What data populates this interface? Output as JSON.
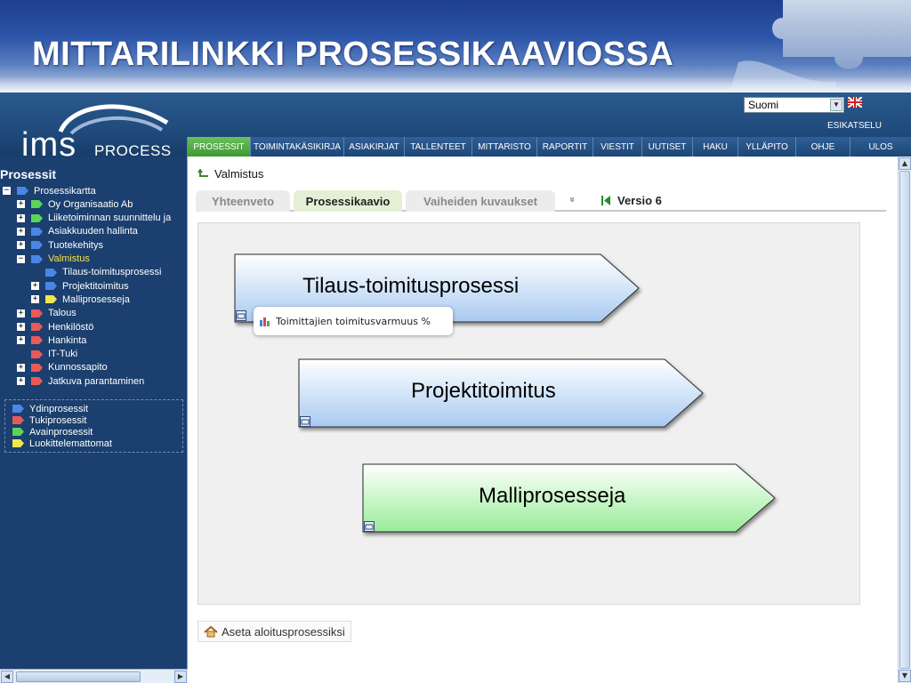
{
  "banner": {
    "title": "MITTARILINKKI PROSESSIKAAVIOSSA"
  },
  "header": {
    "logo_main": "IMS",
    "logo_sub": "PROCESS",
    "language_selected": "Suomi",
    "preview_label": "ESIKATSELU"
  },
  "nav": {
    "items": [
      {
        "label": "PROSESSIT",
        "active": true
      },
      {
        "label": "TOIMINTAKÄSIKIRJA"
      },
      {
        "label": "ASIAKIRJAT"
      },
      {
        "label": "TALLENTEET"
      },
      {
        "label": "MITTARISTO"
      },
      {
        "label": "RAPORTIT"
      },
      {
        "label": "VIESTIT"
      },
      {
        "label": "UUTISET"
      },
      {
        "label": "HAKU"
      },
      {
        "label": "YLLÄPITO"
      },
      {
        "label": "OHJE"
      },
      {
        "label": "ULOS"
      }
    ]
  },
  "sidebar": {
    "title": "Prosessit",
    "tree": [
      {
        "label": "Prosessikartta",
        "expander": "−",
        "color": "#4a86e8"
      },
      {
        "label": "Oy Organisaatio Ab",
        "expander": "+",
        "color": "#5bd45b"
      },
      {
        "label": "Liiketoiminnan suunnittelu ja",
        "expander": "+",
        "color": "#5bd45b"
      },
      {
        "label": "Asiakkuuden hallinta",
        "expander": "+",
        "color": "#4a86e8"
      },
      {
        "label": "Tuotekehitys",
        "expander": "+",
        "color": "#4a86e8"
      },
      {
        "label": "Valmistus",
        "expander": "−",
        "color": "#4a86e8",
        "selected": true
      },
      {
        "label": "Tilaus-toimitusprosessi",
        "expander": "",
        "color": "#4a86e8"
      },
      {
        "label": "Projektitoimitus",
        "expander": "+",
        "color": "#4a86e8"
      },
      {
        "label": "Malliprosesseja",
        "expander": "+",
        "color": "#f3e64d"
      },
      {
        "label": "Talous",
        "expander": "+",
        "color": "#e85a5a"
      },
      {
        "label": "Henkilöstö",
        "expander": "+",
        "color": "#e85a5a"
      },
      {
        "label": "Hankinta",
        "expander": "+",
        "color": "#e85a5a"
      },
      {
        "label": "IT-Tuki",
        "expander": "",
        "color": "#e85a5a"
      },
      {
        "label": "Kunnossapito",
        "expander": "+",
        "color": "#e85a5a"
      },
      {
        "label": "Jatkuva parantaminen",
        "expander": "+",
        "color": "#e85a5a"
      }
    ],
    "legend": [
      {
        "label": "Ydinprosessit",
        "color": "#4a86e8"
      },
      {
        "label": "Tukiprosessit",
        "color": "#e85a5a"
      },
      {
        "label": "Avainprosessit",
        "color": "#5bd45b"
      },
      {
        "label": "Luokittelemattomat",
        "color": "#f3e64d"
      }
    ]
  },
  "content": {
    "breadcrumb": "Valmistus",
    "tabs": [
      {
        "label": "Yhteenveto"
      },
      {
        "label": "Prosessikaavio",
        "active": true
      },
      {
        "label": "Vaiheiden kuvaukset"
      }
    ],
    "more_icon": "»",
    "version_label": "Versio 6",
    "diagram": {
      "processes": [
        {
          "label": "Tilaus-toimitusprosessi",
          "color": "blue"
        },
        {
          "label": "Projektitoimitus",
          "color": "blue"
        },
        {
          "label": "Malliprosesseja",
          "color": "green"
        }
      ],
      "tooltip": "Toimittajien toimitusvarmuus %"
    },
    "home_link": "Aseta aloitusprosessiksi"
  }
}
